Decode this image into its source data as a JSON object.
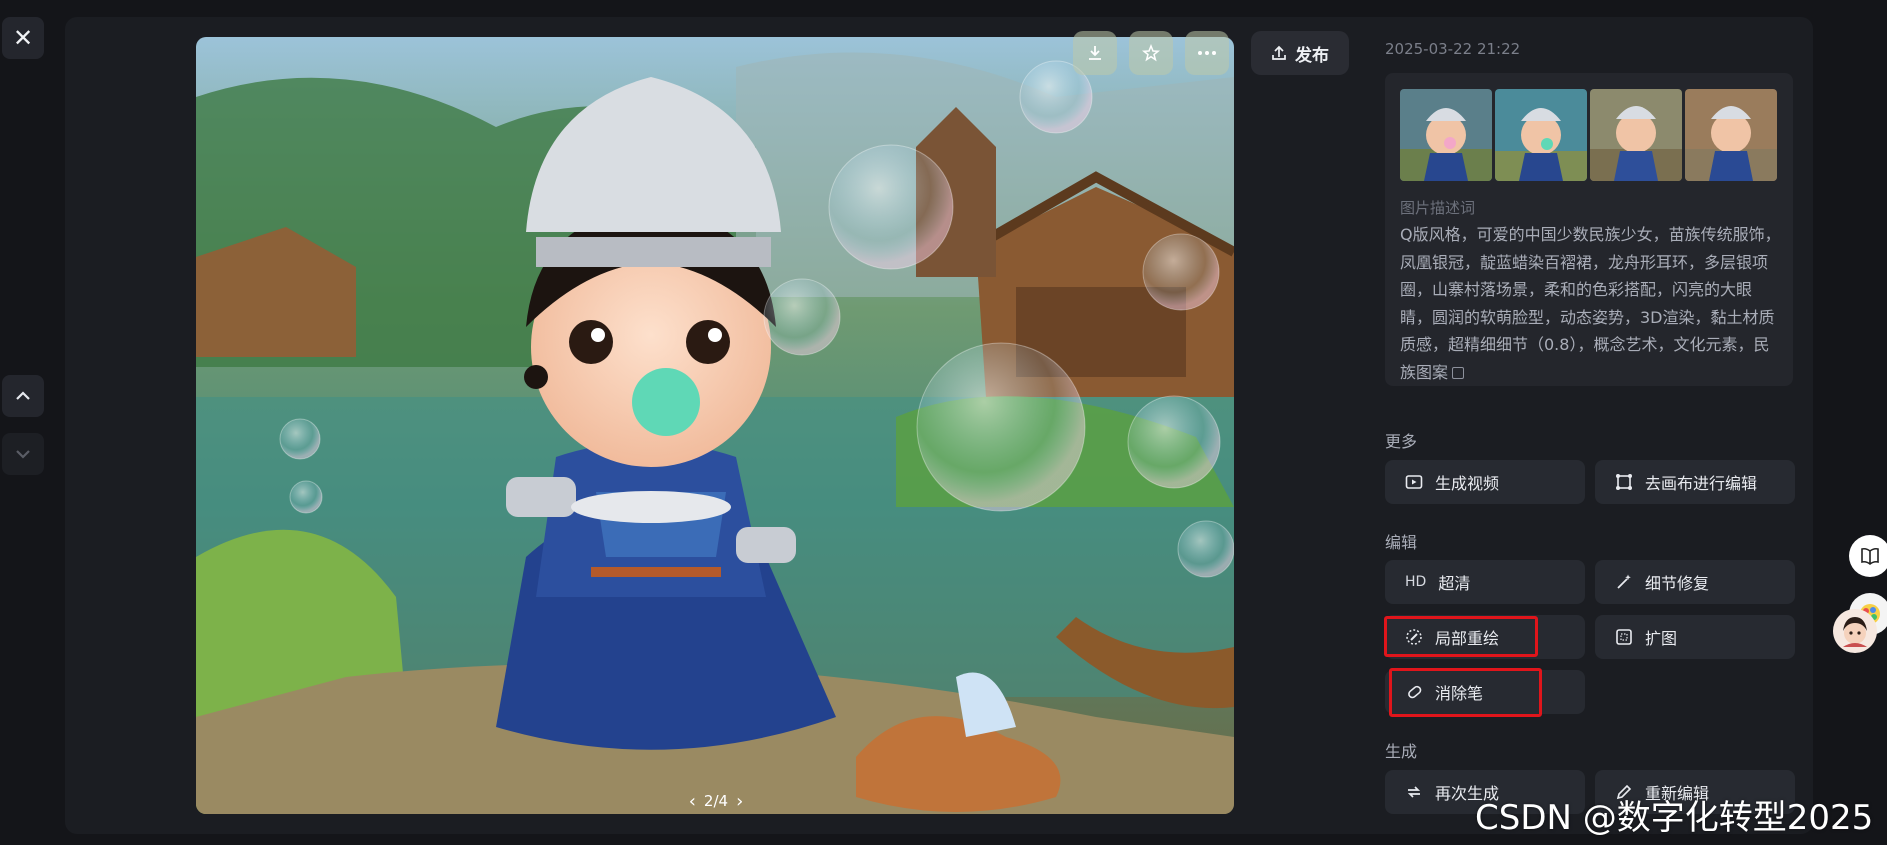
{
  "header": {
    "timestamp": "2025-03-22 21:22",
    "publish_label": "发布"
  },
  "viewer": {
    "pager_text": "2/4",
    "icons": [
      "download-icon",
      "star-icon",
      "more-icon"
    ]
  },
  "description": {
    "label": "图片描述词",
    "text": "Q版风格，可爱的中国少数民族少女，苗族传统服饰，凤凰银冠，靛蓝蜡染百褶裙，龙舟形耳环，多层银项圈，山寨村落场景，柔和的色彩搭配，闪亮的大眼睛，圆润的软萌脸型，动态姿势，3D渲染，黏土材质质感，超精细细节（0.8），概念艺术，文化元素，民族图案"
  },
  "sections": {
    "more": {
      "title": "更多",
      "generate_video": "生成视频",
      "canvas_edit": "去画布进行编辑"
    },
    "edit": {
      "title": "编辑",
      "hd_badge": "HD",
      "hd_label": "超清",
      "detail_fix": "细节修复",
      "inpaint": "局部重绘",
      "expand": "扩图",
      "eraser": "消除笔"
    },
    "generate": {
      "title": "生成",
      "regenerate": "再次生成",
      "reedit": "重新编辑"
    }
  },
  "watermark": "CSDN @数字化转型2025",
  "colors": {
    "background": "#141519",
    "panel": "#1b1d22",
    "button": "#272a31",
    "highlight": "#e0151b"
  }
}
